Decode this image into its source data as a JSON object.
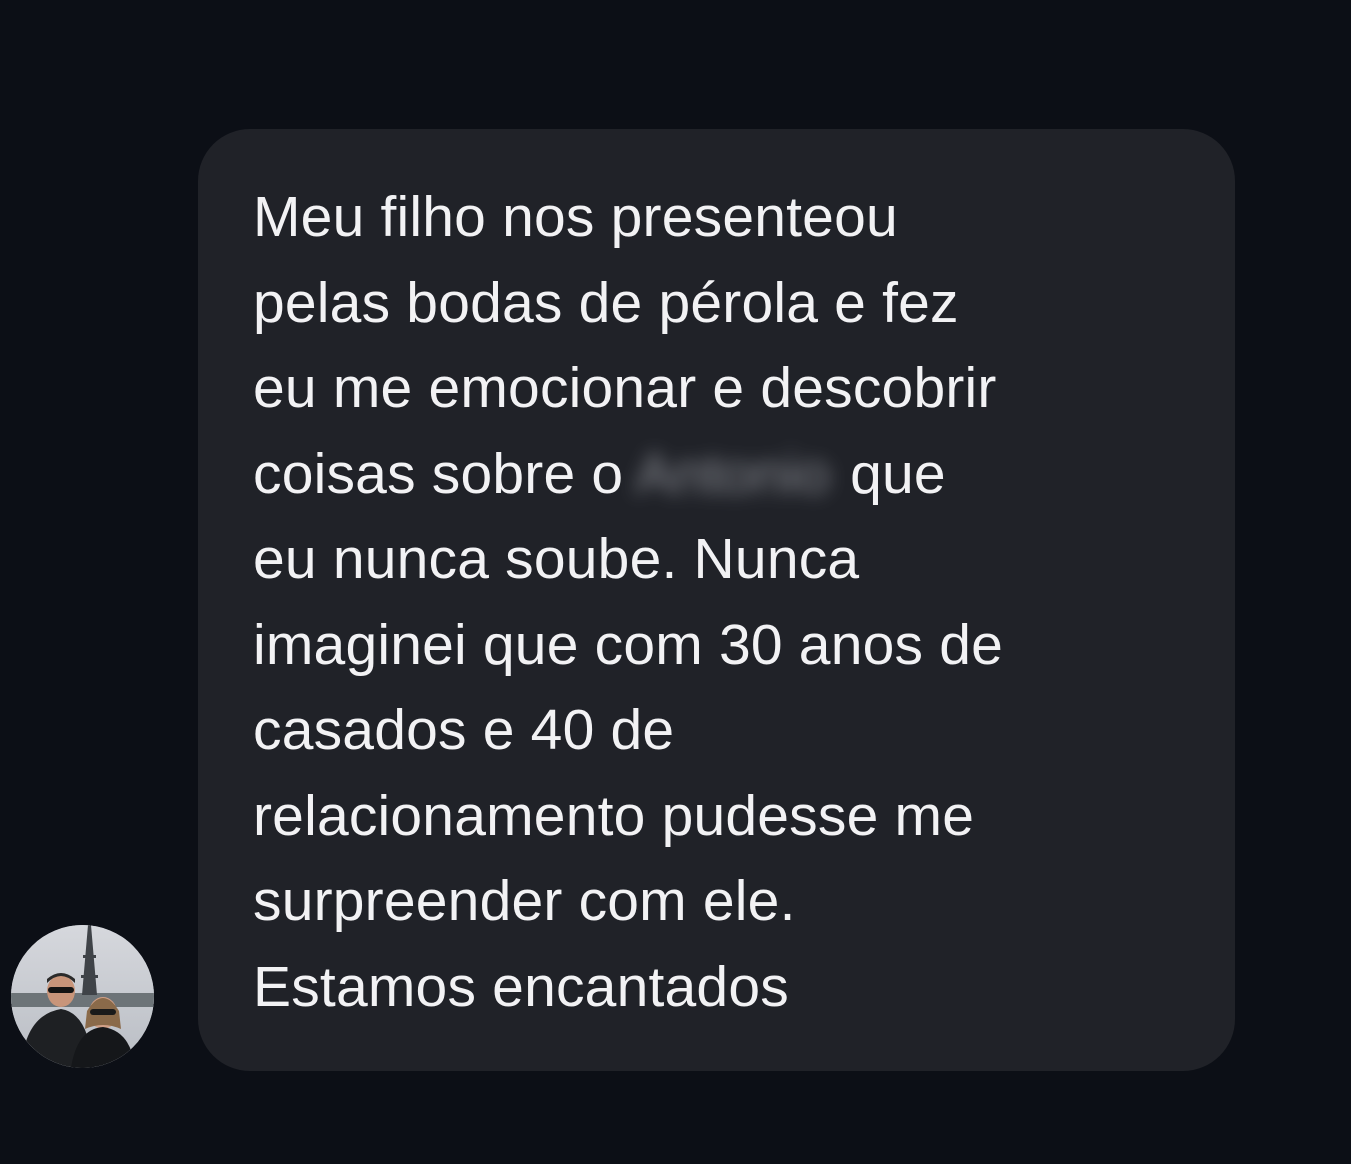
{
  "message": {
    "lines": [
      "Meu filho nos presenteou",
      "pelas bodas de pérola  e fez",
      "eu me emocionar e descobrir",
      "coisas sobre o",
      "que",
      "eu nunca soube. Nunca",
      "imaginei que com 30 anos de",
      "casados e 40 de",
      "relacionamento pudesse me",
      "surpreender com ele.",
      "Estamos encantados"
    ],
    "redacted_name": "Antonio"
  },
  "sender": {
    "avatar_icon": "profile-photo-avatar"
  },
  "colors": {
    "background": "#0c0f16",
    "bubble": "#202228",
    "text": "#f2f2f4"
  }
}
